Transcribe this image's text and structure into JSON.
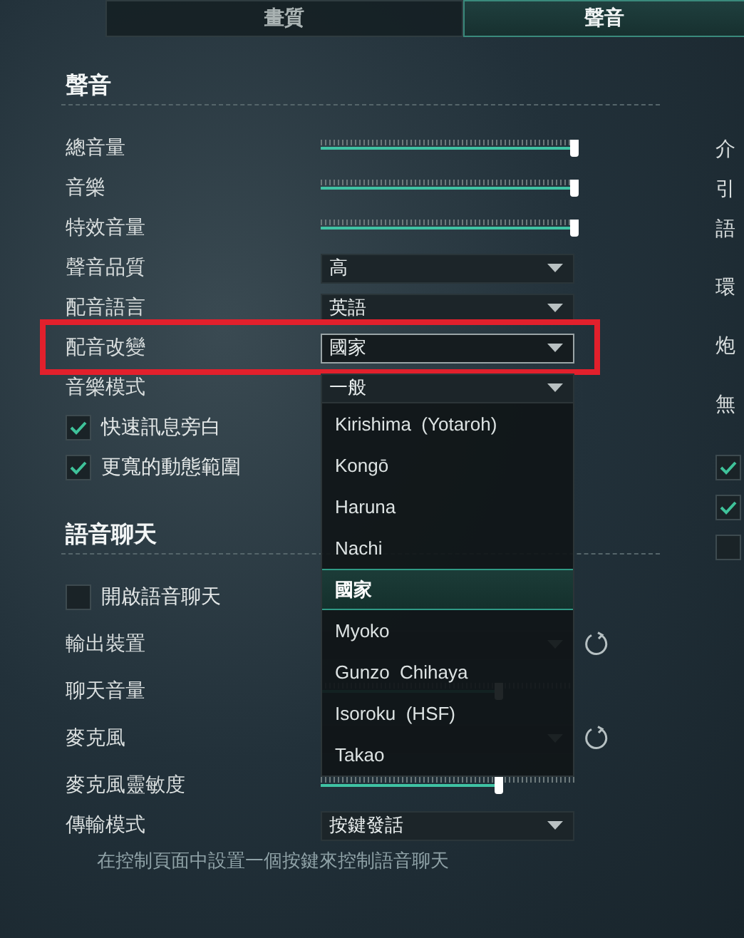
{
  "tabs": [
    {
      "label": "畫質",
      "selected": false
    },
    {
      "label": "聲音",
      "selected": true
    }
  ],
  "sections": [
    {
      "title": "聲音",
      "rows": [
        {
          "kind": "slider",
          "label": "總音量",
          "level": 1,
          "highlighted": false
        },
        {
          "kind": "slider",
          "label": "音樂",
          "level": 1,
          "highlighted": false
        },
        {
          "kind": "slider",
          "label": "特效音量",
          "level": 1,
          "highlighted": false
        },
        {
          "kind": "select",
          "label": "聲音品質",
          "value": "高",
          "open": false,
          "highlighted": false
        },
        {
          "kind": "select",
          "label": "配音語言",
          "value": "英語",
          "open": false,
          "highlighted": false
        },
        {
          "kind": "select",
          "label": "配音改變",
          "value": "國家",
          "open": true,
          "highlighted": true
        },
        {
          "kind": "select",
          "label": "音樂模式",
          "value": "一般",
          "open": false,
          "highlighted": false
        },
        {
          "kind": "check",
          "label": "快速訊息旁白",
          "checked": true,
          "highlighted": false
        },
        {
          "kind": "check",
          "label": "更寬的動態範圍",
          "checked": true,
          "highlighted": false
        }
      ]
    },
    {
      "title": "語音聊天",
      "rows": [
        {
          "kind": "check",
          "label": "開啟語音聊天",
          "checked": false,
          "highlighted": false
        },
        {
          "kind": "select",
          "label": "輸出裝置",
          "open": false,
          "refresh": true,
          "highlighted": false
        },
        {
          "kind": "slider",
          "label": "聊天音量",
          "level": 0.7,
          "highlighted": false
        },
        {
          "kind": "select",
          "label": "麥克風",
          "open": false,
          "refresh": true,
          "highlighted": false
        },
        {
          "kind": "slider",
          "label": "麥克風靈敏度",
          "level": 0.7,
          "highlighted": false
        },
        {
          "kind": "select",
          "label": "傳輸模式",
          "value": "按鍵發話",
          "open": false,
          "highlighted": false
        },
        {
          "kind": "hint",
          "text": "在控制頁面中設置一個按鍵來控制語音聊天"
        }
      ]
    }
  ],
  "dropdown": {
    "options": [
      {
        "label": "Kirishima  (Yotaroh)",
        "selected": false
      },
      {
        "label": "Kongō",
        "selected": false
      },
      {
        "label": "Haruna",
        "selected": false
      },
      {
        "label": "Nachi",
        "selected": false
      },
      {
        "label": "國家",
        "selected": true
      },
      {
        "label": "Myoko",
        "selected": false
      },
      {
        "label": "Gunzo  Chihaya",
        "selected": false
      },
      {
        "label": "Isoroku  (HSF)",
        "selected": false
      },
      {
        "label": "Takao",
        "selected": false
      }
    ]
  },
  "right_column": [
    {
      "kind": "label",
      "text": "介"
    },
    {
      "kind": "label",
      "text": "引"
    },
    {
      "kind": "label",
      "text": "語"
    },
    {
      "kind": "label",
      "text": "環"
    },
    {
      "kind": "label",
      "text": "炮"
    },
    {
      "kind": "label",
      "text": "無"
    },
    {
      "kind": "check",
      "checked": true
    },
    {
      "kind": "check",
      "checked": true
    },
    {
      "kind": "check",
      "checked": false
    }
  ]
}
